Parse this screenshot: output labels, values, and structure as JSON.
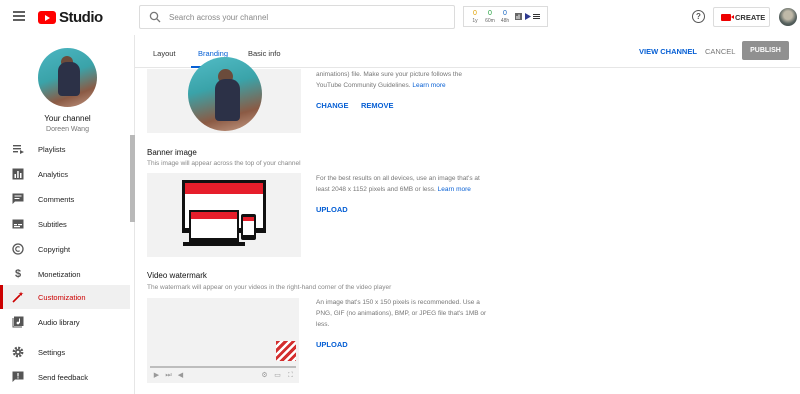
{
  "topbar": {
    "logo_text": "Studio",
    "search_placeholder": "Search across your channel",
    "stats": [
      {
        "value": "0",
        "label": "1y"
      },
      {
        "value": "0",
        "label": "60m"
      },
      {
        "value": "0",
        "label": "48h"
      }
    ],
    "help_label": "?",
    "create_label": "CREATE"
  },
  "sidebar": {
    "channel_title": "Your channel",
    "channel_name": "Doreen Wang",
    "items": [
      {
        "label": "Playlists",
        "icon": "playlist-icon"
      },
      {
        "label": "Analytics",
        "icon": "analytics-icon"
      },
      {
        "label": "Comments",
        "icon": "comments-icon"
      },
      {
        "label": "Subtitles",
        "icon": "subtitles-icon"
      },
      {
        "label": "Copyright",
        "icon": "copyright-icon"
      },
      {
        "label": "Monetization",
        "icon": "monetization-icon"
      },
      {
        "label": "Customization",
        "icon": "customization-icon",
        "active": true
      },
      {
        "label": "Audio library",
        "icon": "audio-library-icon"
      },
      {
        "label": "Settings",
        "icon": "settings-icon"
      },
      {
        "label": "Send feedback",
        "icon": "feedback-icon"
      }
    ]
  },
  "tabs": [
    {
      "label": "Layout"
    },
    {
      "label": "Branding",
      "active": true
    },
    {
      "label": "Basic info"
    }
  ],
  "header_actions": {
    "view_channel": "VIEW CHANNEL",
    "cancel": "CANCEL",
    "publish": "PUBLISH"
  },
  "picture": {
    "desc_line1": "animations) file. Make sure your picture follows the",
    "desc_line2": "YouTube Community Guidelines.",
    "learn_more": "Learn more",
    "change": "CHANGE",
    "remove": "REMOVE"
  },
  "banner": {
    "title": "Banner image",
    "subtitle": "This image will appear across the top of your channel",
    "desc_line1": "For the best results on all devices, use an image that's at",
    "desc_line2": "least 2048 x 1152 pixels and 6MB or less.",
    "learn_more": "Learn more",
    "upload": "UPLOAD"
  },
  "watermark": {
    "title": "Video watermark",
    "subtitle": "The watermark will appear on your videos in the right-hand corner of the video player",
    "desc_line1": "An image that's 150 x 150 pixels is recommended. Use a",
    "desc_line2": "PNG, GIF (no animations), BMP, or JPEG file that's 1MB or",
    "desc_line3": "less.",
    "upload": "UPLOAD"
  },
  "colors": {
    "accent_blue": "#065fd4",
    "brand_red": "#cc0000"
  }
}
